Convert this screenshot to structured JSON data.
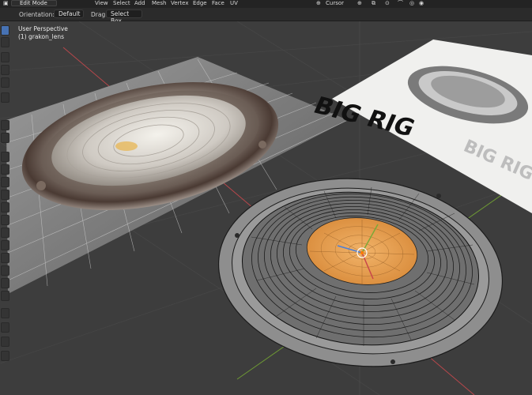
{
  "topbar": {
    "mode": "Edit Mode",
    "menus": [
      "View",
      "Select",
      "Add",
      "Mesh",
      "Vertex",
      "Edge",
      "Face",
      "UV"
    ],
    "pivot": "Cursor"
  },
  "header": {
    "orientation_label": "Orientation:",
    "orientation_value": "Default",
    "drag_label": "Drag:",
    "drag_value": "Select Box"
  },
  "viewport": {
    "perspective": "User Perspective",
    "object": "(1) grakon_lens"
  },
  "colors": {
    "accent": "#4772b3",
    "selection": "#e8973a",
    "x_axis": "#c8464a",
    "y_axis": "#7da837"
  }
}
